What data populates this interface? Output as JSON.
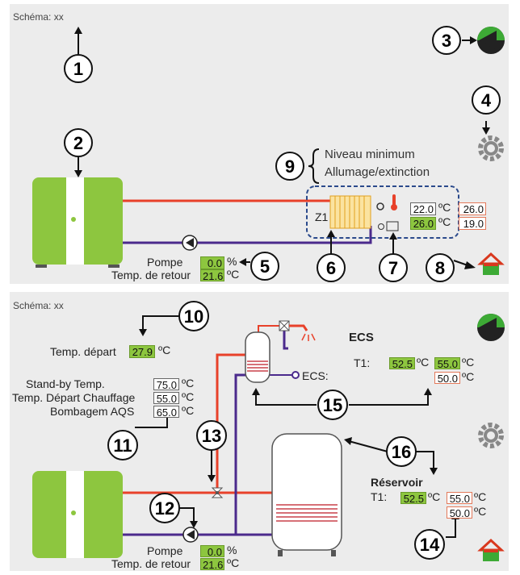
{
  "top": {
    "schema_label": "Schéma: xx",
    "niveau_minimum": "Niveau minimum",
    "allumage": "Allumage/extinction",
    "zone_label": "Z1",
    "temp_row1": {
      "value": "22.0",
      "unit": "ºC",
      "extra": "26.0"
    },
    "temp_row2": {
      "value": "26.0",
      "unit": "ºC",
      "extra": "19.0"
    },
    "pompe_label": "Pompe",
    "pompe_value": "0.0",
    "pompe_unit": "%",
    "retour_label": "Temp. de retour",
    "retour_value": "21.6",
    "retour_unit": "ºC",
    "callouts": [
      "1",
      "2",
      "3",
      "4",
      "5",
      "6",
      "7",
      "8",
      "9"
    ]
  },
  "bottom": {
    "schema_label": "Schéma: xx",
    "depart_label": "Temp. départ",
    "depart_value": "27.9",
    "depart_unit": "ºC",
    "standby_label": "Stand-by Temp.",
    "standby_value": "75.0",
    "depart_chauffage_label": "Temp. Départ Chauffage",
    "depart_chauffage_value": "55.0",
    "bombagem_label": "Bombagem AQS",
    "bombagem_value": "65.0",
    "setting_unit": "ºC",
    "ecs_title": "ECS",
    "ecs_t1_label": "T1:",
    "ecs_t1_value": "52.5",
    "ecs_t1_set": "55.0",
    "ecs_t1_set2": "50.0",
    "ecs_pipe_label": "ECS:",
    "ecs_unit": "ºC",
    "reservoir_title": "Réservoir",
    "res_t1_label": "T1:",
    "res_t1_value": "52.5",
    "res_t1_set": "55.0",
    "res_t1_set2": "50.0",
    "res_unit": "ºC",
    "pompe_label": "Pompe",
    "pompe_value": "0.0",
    "pompe_unit": "%",
    "retour_label": "Temp. de retour",
    "retour_value": "21.6",
    "retour_unit": "ºC",
    "callouts": [
      "10",
      "11",
      "12",
      "13",
      "14",
      "15",
      "16"
    ]
  },
  "colors": {
    "panel_bg": "#ececec",
    "boiler_green": "#8dc63f",
    "supply_red": "#e8412a",
    "return_purple": "#4b2a8c",
    "value_green": "#8dc63f",
    "home_red": "#d9381e",
    "back_arrow_green": "#3daa35"
  },
  "icons": [
    "back-arrow-icon",
    "gear-icon",
    "home-icon",
    "pump-icon",
    "radiator-icon",
    "thermometer-icon",
    "shower-icon",
    "valve-icon"
  ]
}
